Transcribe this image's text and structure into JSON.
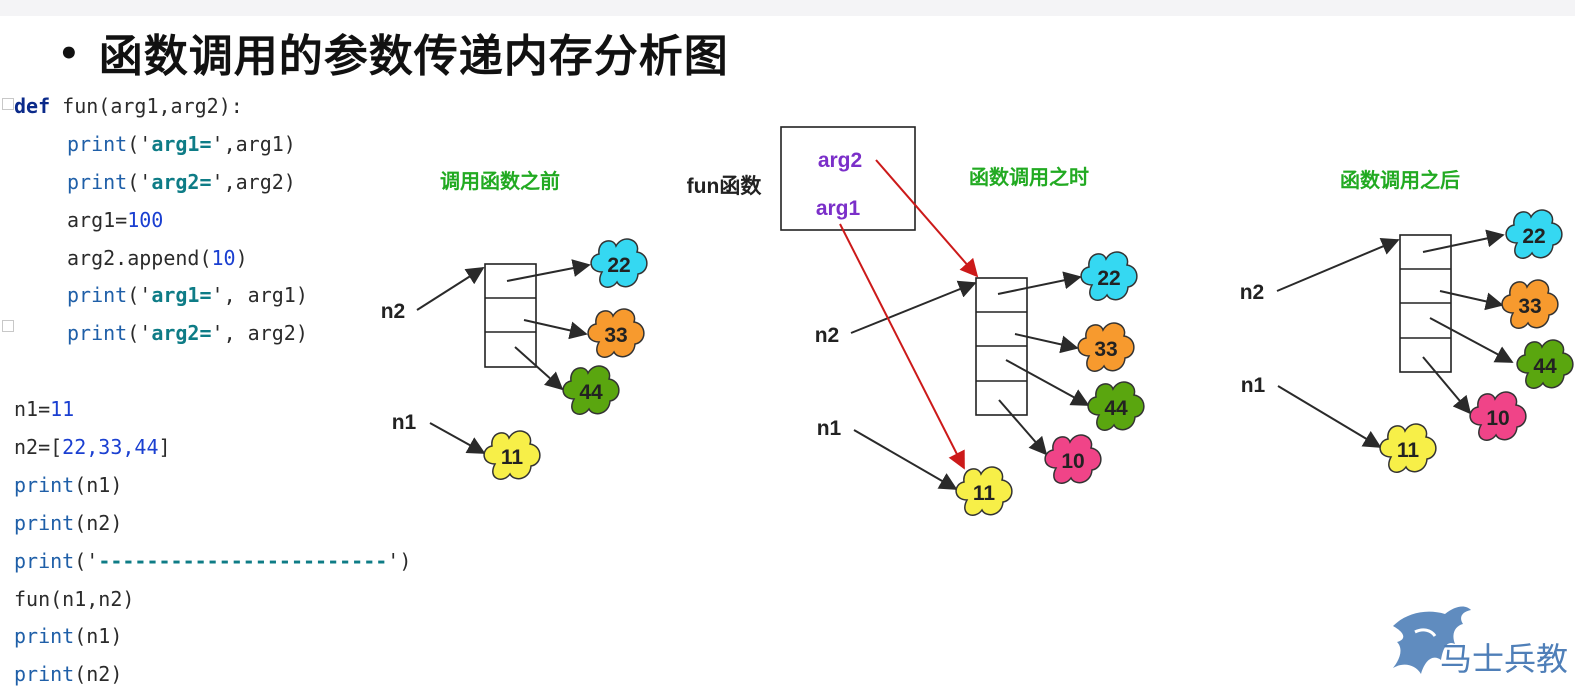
{
  "title": "函数调用的参数传递内存分析图",
  "code_lines": [
    {
      "kw": "def",
      "rest": " fun(arg1,arg2):"
    },
    {
      "fn": "print",
      "pre": "('",
      "str": "arg1=",
      "post": "',arg1)"
    },
    {
      "fn": "print",
      "pre": "('",
      "str": "arg2=",
      "post": "',arg2)"
    },
    {
      "a": "arg1=",
      "num": "100"
    },
    {
      "a": "arg2.append(",
      "num": "10",
      "b": ")"
    },
    {
      "fn": "print",
      "pre": "('",
      "str": "arg1=",
      "post": "', arg1)"
    },
    {
      "fn": "print",
      "pre": "('",
      "str": "arg2=",
      "post": "', arg2)"
    },
    {
      "a": "n1=",
      "num": "11"
    },
    {
      "a": "n2=[",
      "num": "22,33,44",
      "b": "]"
    },
    {
      "fn": "print",
      "post": "(n1)"
    },
    {
      "fn": "print",
      "post": "(n2)"
    },
    {
      "fn": "print",
      "pre": "('",
      "str2": "------------------------",
      "post": "')"
    },
    {
      "a": "fun(n1,n2)"
    },
    {
      "fn": "print",
      "post": "(n1)"
    },
    {
      "fn": "print",
      "post": "(n2)"
    }
  ],
  "diagram": {
    "before_label": "调用函数之前",
    "during_label": "函数调用之时",
    "after_label": "函数调用之后",
    "fun_label": "fun函数",
    "arg1": "arg1",
    "arg2": "arg2",
    "n1": "n1",
    "n2": "n2",
    "values": [
      "22",
      "33",
      "44",
      "11",
      "10"
    ]
  },
  "colors": {
    "stage_label": "#22aa22",
    "arg_label": "#7b2fc9",
    "arrow_red": "#cc1a1a",
    "cloud_22": "#35d8f2",
    "cloud_33": "#f79a2e",
    "cloud_44": "#5aa60f",
    "cloud_11": "#f7ef48",
    "cloud_10": "#f04488"
  },
  "logo_text": "马士兵教"
}
